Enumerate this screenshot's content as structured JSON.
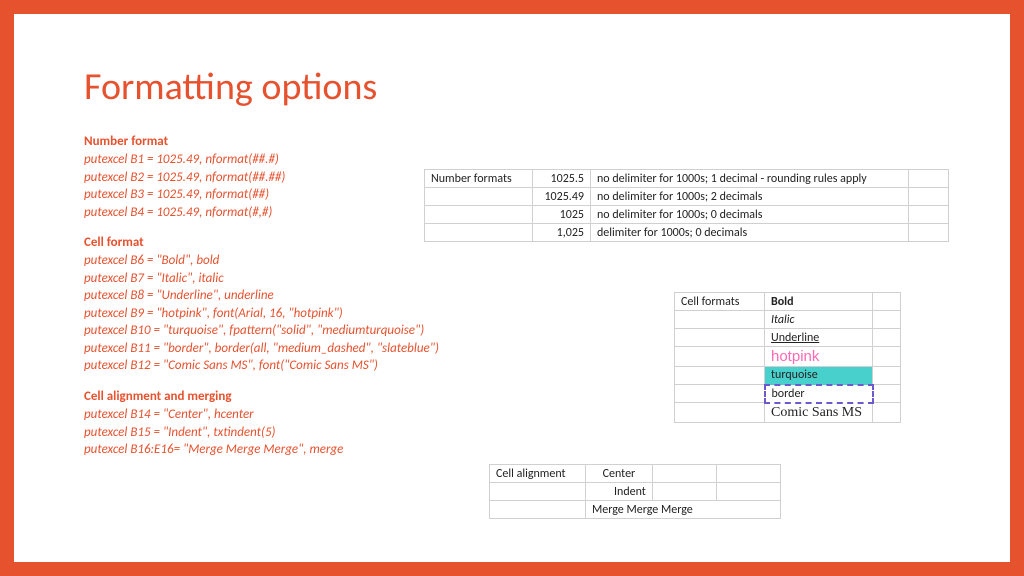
{
  "title": "Formatting options",
  "sections": {
    "num_head": "Number format",
    "num_lines": [
      "putexcel B1 = 1025.49, nformat(##.#)",
      "putexcel B2 = 1025.49, nformat(##.##)",
      "putexcel B3 = 1025.49, nformat(##)",
      "putexcel B4 = 1025.49, nformat(#,#)"
    ],
    "cell_head": "Cell format",
    "cell_lines": [
      "putexcel B6 = \"Bold\", bold",
      "putexcel B7 = \"Italic\", italic",
      "putexcel B8 = \"Underline\", underline",
      "putexcel B9 = \"hotpink\", font(Arial, 16, \"hotpink\")",
      "putexcel B10 = \"turquoise\", fpattern(\"solid\", \"mediumturquoise\")",
      "putexcel B11 = \"border\", border(all, \"medium_dashed\", \"slateblue\")",
      "putexcel B12 = \"Comic Sans MS\", font(\"Comic Sans MS\")"
    ],
    "align_head": "Cell alignment and merging",
    "align_lines": [
      "putexcel B14 = \"Center\", hcenter",
      "putexcel B15 = \"Indent\", txtindent(5)",
      "putexcel B16:E16= \"Merge Merge Merge\", merge"
    ]
  },
  "num_table": {
    "label": "Number formats",
    "rows": [
      {
        "v": "1025.5",
        "d": "no delimiter for 1000s; 1 decimal - rounding rules apply"
      },
      {
        "v": "1025.49",
        "d": "no delimiter for 1000s; 2 decimals"
      },
      {
        "v": "1025",
        "d": "no delimiter for 1000s; 0 decimals"
      },
      {
        "v": "1,025",
        "d": "delimiter for 1000s; 0  decimals"
      }
    ]
  },
  "cell_table": {
    "label": "Cell formats",
    "rows": [
      "Bold",
      "Italic",
      "Underline",
      "hotpink",
      "turquoise",
      "border",
      "Comic Sans MS"
    ]
  },
  "align_table": {
    "label": "Cell alignment",
    "center": "Center",
    "indent": "Indent",
    "merge": "Merge Merge Merge"
  }
}
